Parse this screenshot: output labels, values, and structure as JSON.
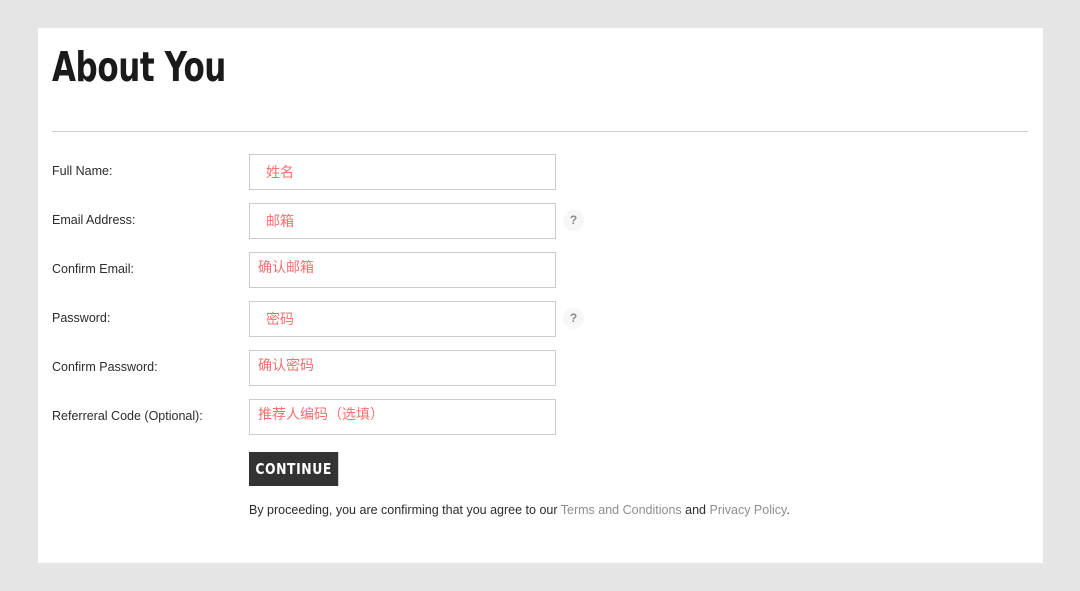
{
  "page": {
    "title": "About You",
    "background_color": "#e5e5e5",
    "card_color": "#ffffff"
  },
  "form": {
    "placeholder_color": "#f4706f",
    "fields": [
      {
        "label": "Full Name:",
        "placeholder": "姓名",
        "help_icon": "",
        "has_help": false,
        "tight": false
      },
      {
        "label": "Email Address:",
        "placeholder": "邮箱",
        "help_icon": "?",
        "has_help": true,
        "tight": false
      },
      {
        "label": "Confirm Email:",
        "placeholder": "确认邮箱",
        "help_icon": "",
        "has_help": false,
        "tight": true
      },
      {
        "label": "Password:",
        "placeholder": "密码",
        "help_icon": "?",
        "has_help": true,
        "tight": false
      },
      {
        "label": "Confirm Password:",
        "placeholder": "确认密码",
        "help_icon": "",
        "has_help": false,
        "tight": true
      },
      {
        "label": "Referreral Code (Optional):",
        "placeholder": "推荐人编码（选填）",
        "help_icon": "",
        "has_help": false,
        "tight": true
      }
    ]
  },
  "submit": {
    "label": "CONTINUE",
    "background_color": "#333333"
  },
  "legal": {
    "prefix": "By proceeding, you are confirming that you agree to our ",
    "terms_link": "Terms and Conditions",
    "conjunction": " and ",
    "privacy_link": "Privacy Policy",
    "suffix": ".",
    "link_color": "#8e8e8e"
  }
}
